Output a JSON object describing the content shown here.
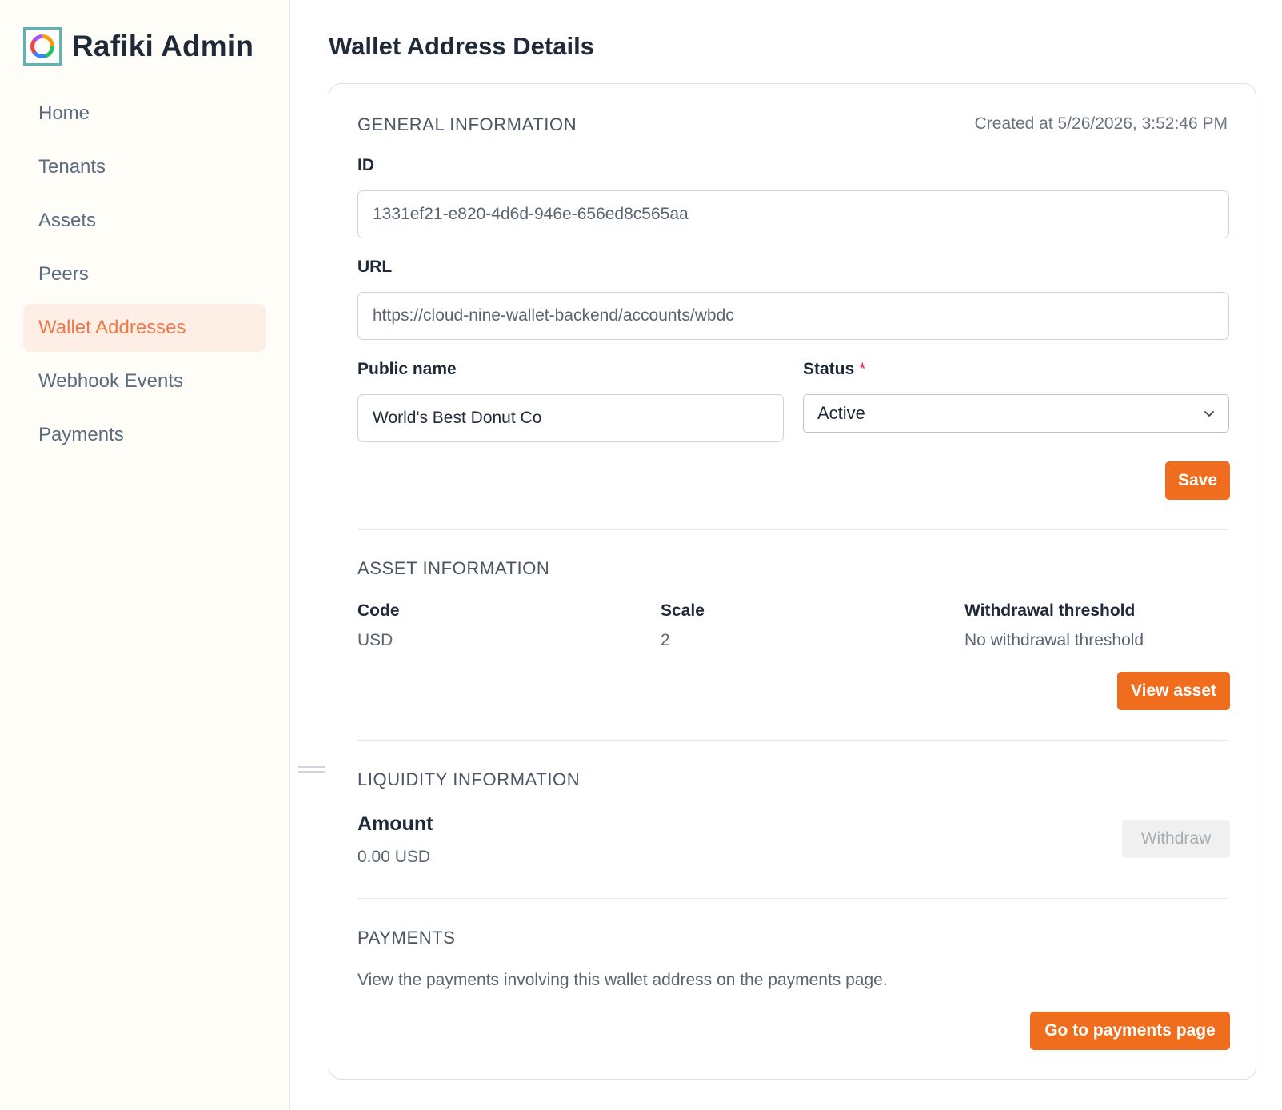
{
  "app": {
    "title": "Rafiki Admin",
    "logo_icon": "rafiki-logo-icon"
  },
  "sidebar": {
    "items": [
      {
        "label": "Home",
        "active": false
      },
      {
        "label": "Tenants",
        "active": false
      },
      {
        "label": "Assets",
        "active": false
      },
      {
        "label": "Peers",
        "active": false
      },
      {
        "label": "Wallet Addresses",
        "active": true
      },
      {
        "label": "Webhook Events",
        "active": false
      },
      {
        "label": "Payments",
        "active": false
      }
    ]
  },
  "page": {
    "title": "Wallet Address Details"
  },
  "general": {
    "section_title": "GENERAL INFORMATION",
    "created_at": "Created at 5/26/2026, 3:52:46 PM",
    "id_label": "ID",
    "id_value": "1331ef21-e820-4d6d-946e-656ed8c565aa",
    "url_label": "URL",
    "url_value": "https://cloud-nine-wallet-backend/accounts/wbdc",
    "public_name_label": "Public name",
    "public_name_value": "World's Best Donut Co",
    "status_label": "Status",
    "status_required": "*",
    "status_value": "Active",
    "save_label": "Save"
  },
  "asset": {
    "section_title": "ASSET INFORMATION",
    "code_label": "Code",
    "code_value": "USD",
    "scale_label": "Scale",
    "scale_value": "2",
    "threshold_label": "Withdrawal threshold",
    "threshold_value": "No withdrawal threshold",
    "view_asset_label": "View asset"
  },
  "liquidity": {
    "section_title": "LIQUIDITY INFORMATION",
    "amount_label": "Amount",
    "amount_value": "0.00 USD",
    "withdraw_label": "Withdraw"
  },
  "payments": {
    "section_title": "PAYMENTS",
    "description": "View the payments involving this wallet address on the payments page.",
    "go_label": "Go to payments page"
  },
  "colors": {
    "accent": "#ef6d1c",
    "active_nav_bg": "#fdeee6",
    "active_nav_text": "#ee7a4a"
  }
}
